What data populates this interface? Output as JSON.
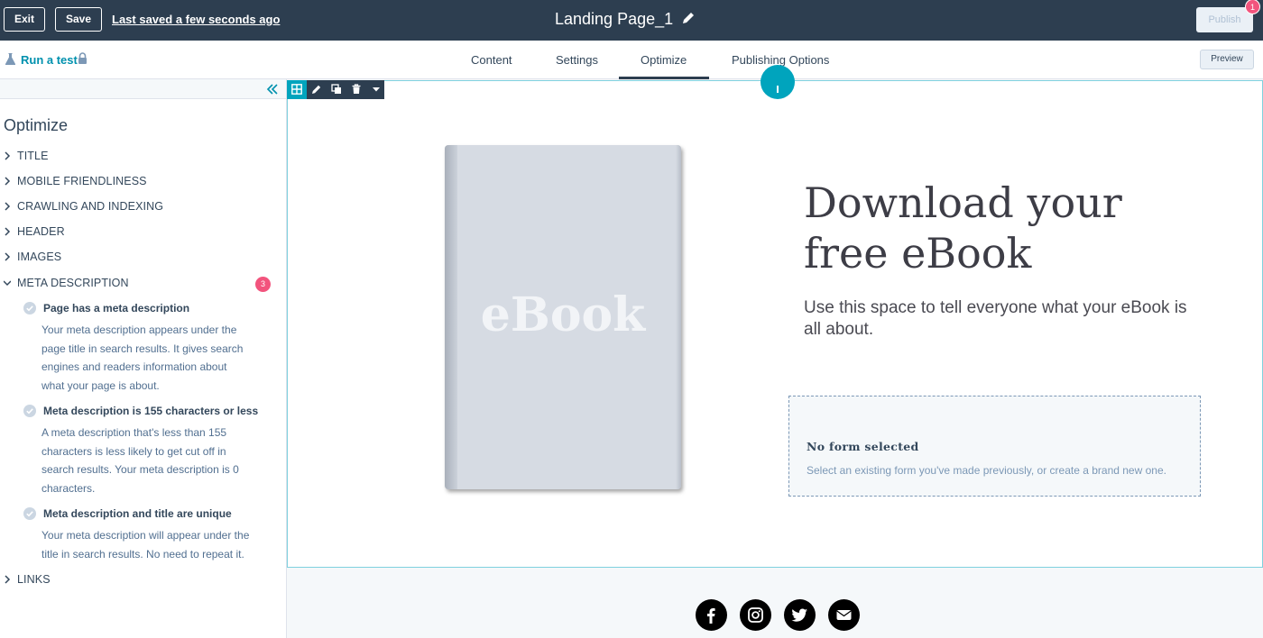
{
  "topbar": {
    "exit_label": "Exit",
    "save_label": "Save",
    "saved_status": "Last saved a few seconds ago",
    "page_title": "Landing Page_1",
    "publish_label": "Publish",
    "publish_badge": "1"
  },
  "subbar": {
    "run_test": "Run a test",
    "tabs": [
      {
        "label": "Content"
      },
      {
        "label": "Settings"
      },
      {
        "label": "Optimize",
        "active": true
      },
      {
        "label": "Publishing Options"
      }
    ],
    "preview_label": "Preview"
  },
  "sidebar": {
    "title": "Optimize",
    "sections": [
      {
        "label": "TITLE",
        "expanded": false
      },
      {
        "label": "MOBILE FRIENDLINESS",
        "expanded": false
      },
      {
        "label": "CRAWLING AND INDEXING",
        "expanded": false
      },
      {
        "label": "HEADER",
        "expanded": false
      },
      {
        "label": "IMAGES",
        "expanded": false
      },
      {
        "label": "META DESCRIPTION",
        "expanded": true,
        "badge": "3"
      },
      {
        "label": "LINKS",
        "expanded": false
      }
    ],
    "rules": [
      {
        "title": "Page has a meta description",
        "lines": [
          "Your meta description appears under the",
          "page title in search results. It gives search",
          "engines and readers information about",
          "what your page is about."
        ]
      },
      {
        "title": "Meta description is 155 characters or less",
        "lines": [
          "A meta description that's less than 155",
          "characters is less likely to get cut off in",
          "search results. Your meta description is 0",
          "characters."
        ]
      },
      {
        "title": "Meta description and title are unique",
        "lines": [
          "Your meta description will appear under the",
          "title in search results. No need to repeat it."
        ]
      }
    ]
  },
  "canvas": {
    "book_text": "eBook",
    "headline_line1": "Download your",
    "headline_line2": "free eBook",
    "subtext": "Use this space to tell everyone what your eBook is all about.",
    "form_title": "No form selected",
    "form_desc": "Select an existing form you've made previously, or create a brand new one."
  },
  "social": [
    "facebook-icon",
    "instagram-icon",
    "twitter-icon",
    "email-icon"
  ],
  "colors": {
    "topbar": "#2d3e50",
    "accent": "#00a4bd",
    "badge": "#f2547d",
    "link": "#0091ae"
  }
}
